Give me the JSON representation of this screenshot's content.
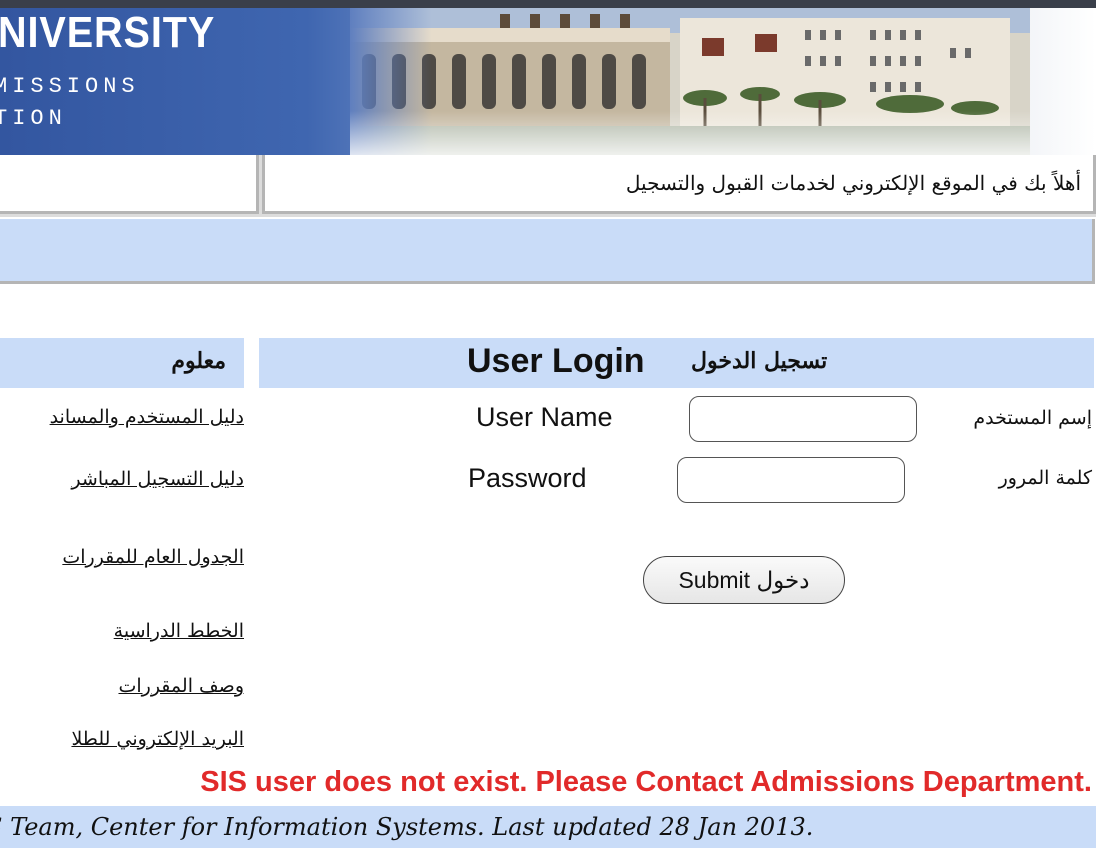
{
  "header": {
    "university_title": "NIVERSITY",
    "admissions_line1": "MISSIONS",
    "admissions_line2": "TION"
  },
  "welcome": {
    "text": "أهلاً بك في الموقع الإلكتروني لخدمات القبول والتسجيل"
  },
  "info_panel": {
    "title": "معلوم",
    "links": [
      "دليل المستخدم والمساند",
      "دليل التسجيل المباشر",
      "الجدول العام للمقررات",
      "الخطط الدراسية",
      "وصف المقررات",
      "البريد الإلكتروني للطلا"
    ]
  },
  "login": {
    "title_en": "User Login",
    "title_ar": "تسجيل الدخول",
    "username_label_en": "User Name",
    "username_label_ar": "إسم المستخدم",
    "username_value": "",
    "password_label_en": "Password",
    "password_label_ar": "كلمة المرور",
    "password_value": "",
    "submit_label": "Submit دخول"
  },
  "error_message": "SIS user does not exist. Please Contact Admissions Department.",
  "footer_text": "S Team, Center for Information Systems. Last updated 28 Jan 2013.",
  "colors": {
    "panel_blue": "#c9dcf8",
    "error_red": "#e12a2a",
    "banner_blue": "#3356a0"
  }
}
